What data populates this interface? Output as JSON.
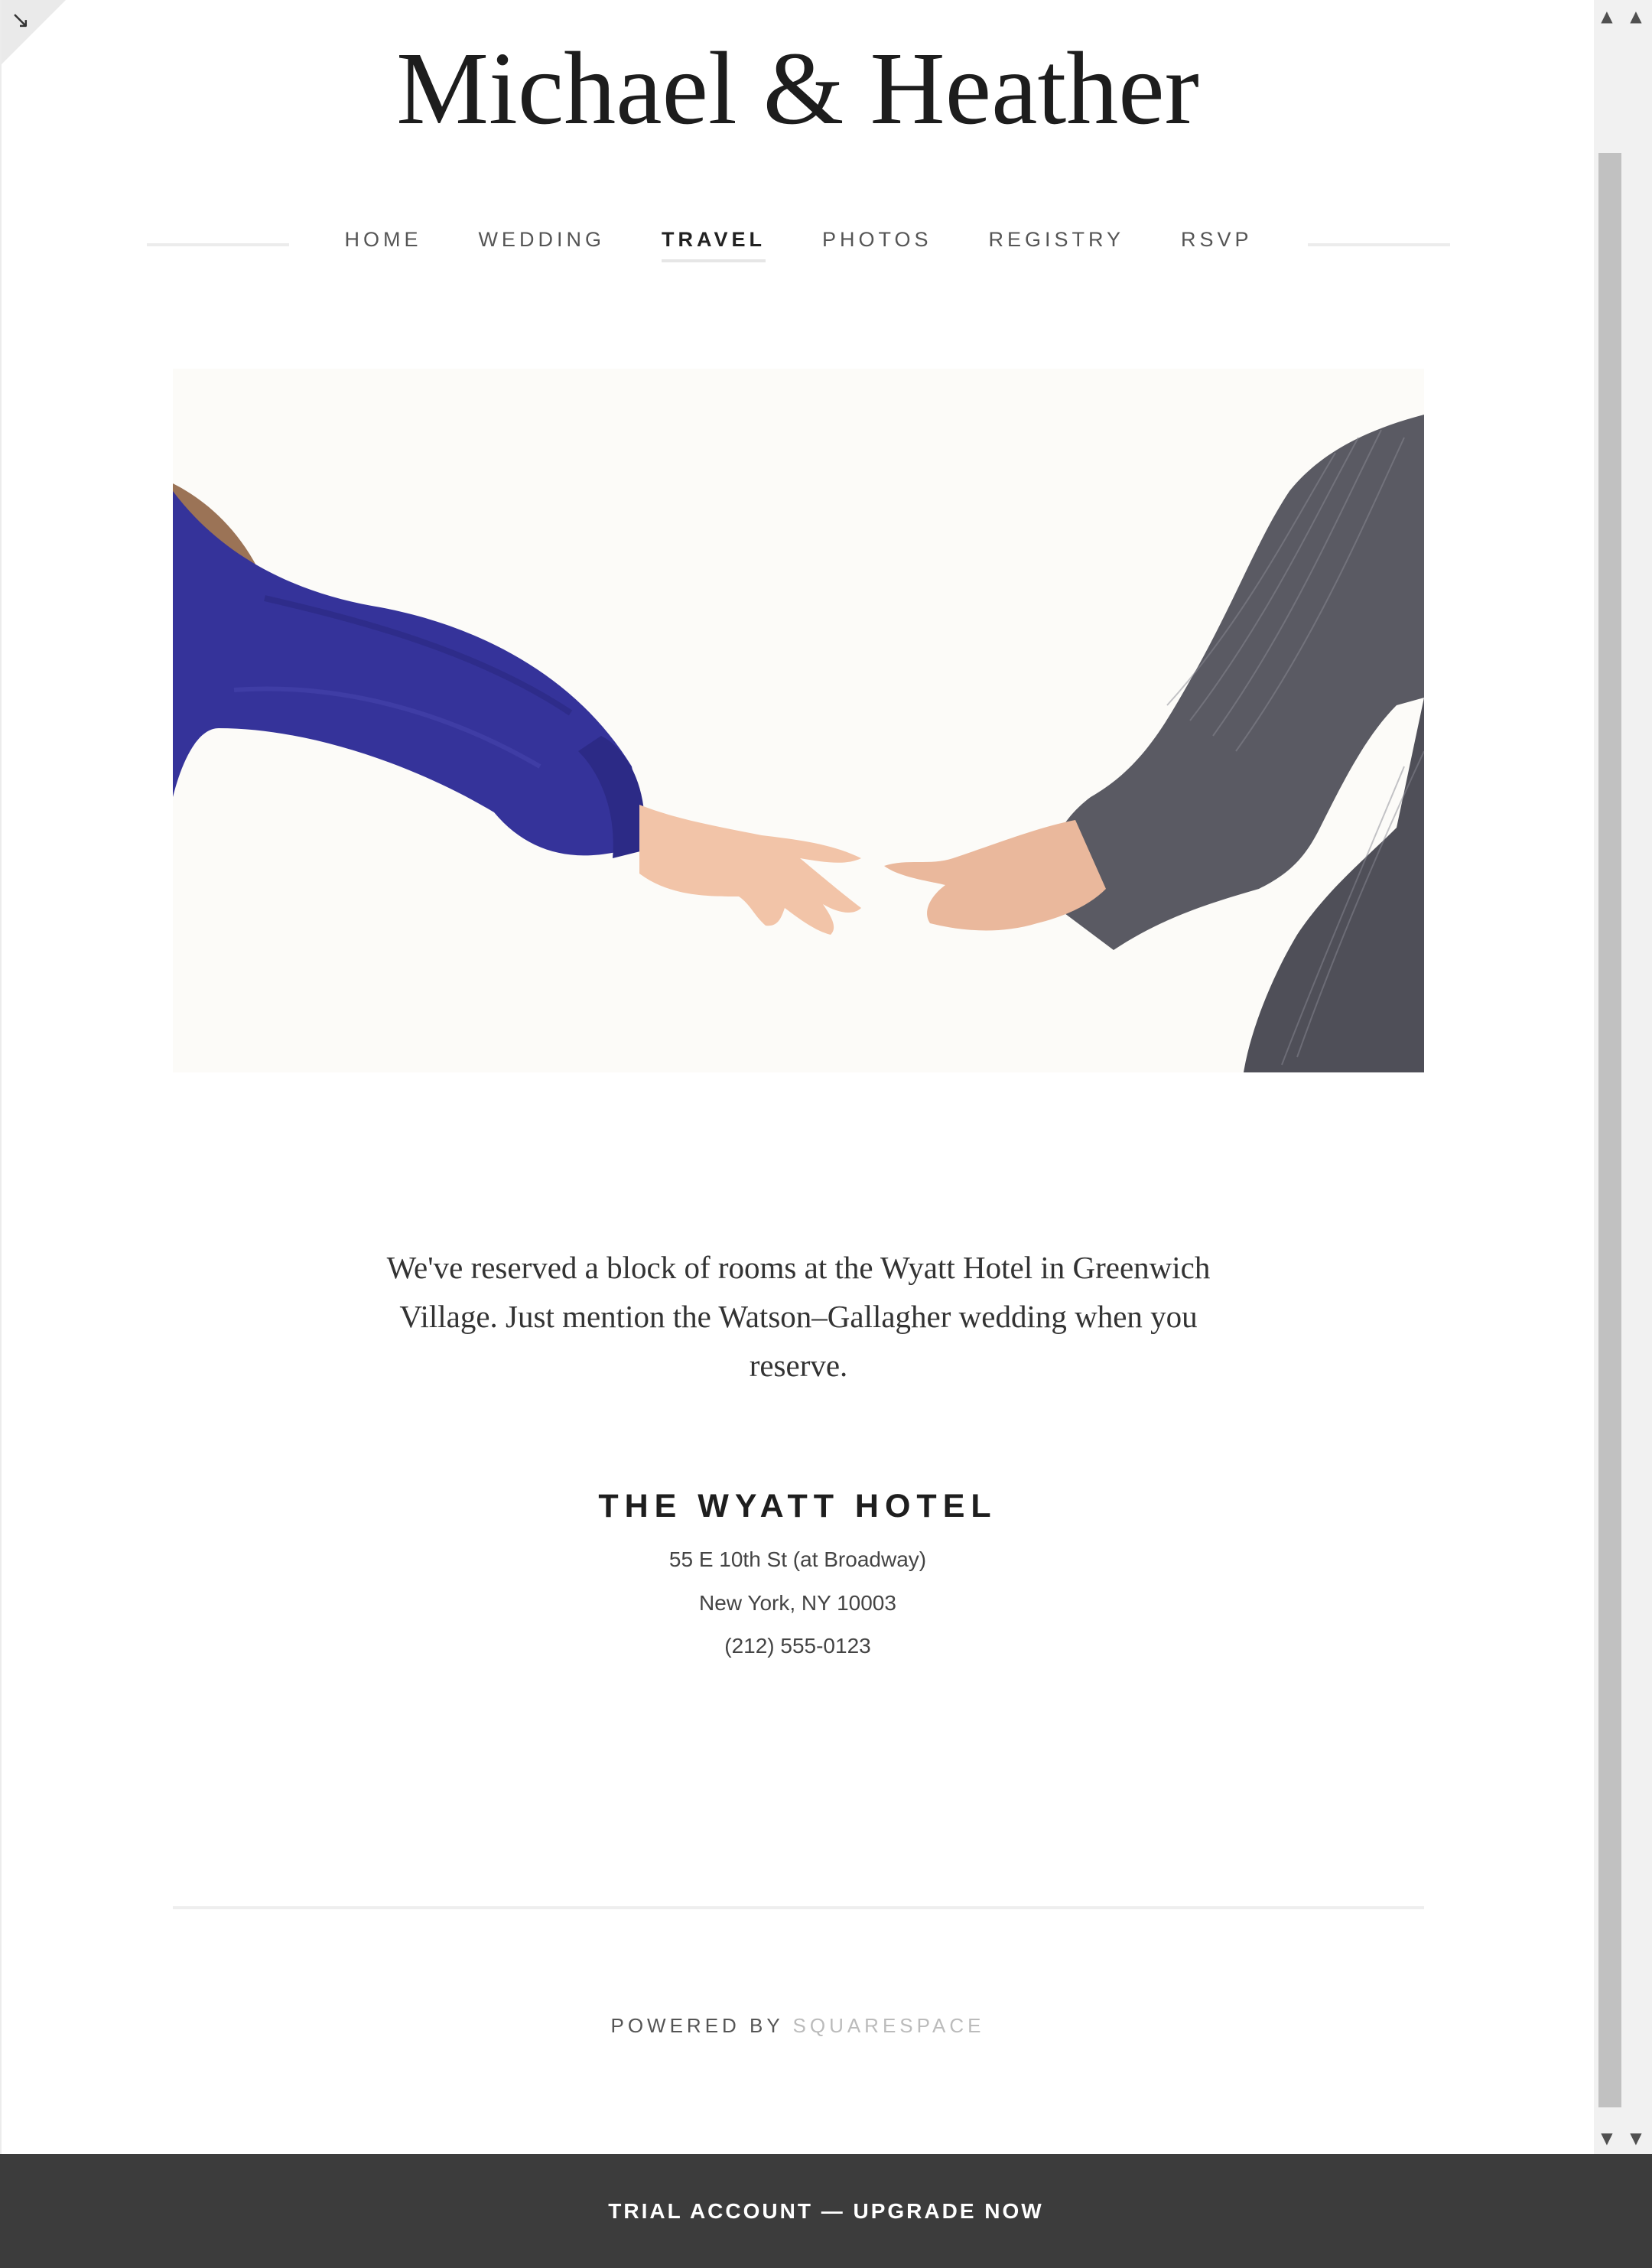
{
  "site": {
    "title": "Michael & Heather"
  },
  "nav": {
    "items": [
      {
        "label": "HOME"
      },
      {
        "label": "WEDDING"
      },
      {
        "label": "TRAVEL",
        "active": true
      },
      {
        "label": "PHOTOS"
      },
      {
        "label": "REGISTRY"
      },
      {
        "label": "RSVP"
      }
    ]
  },
  "main": {
    "intro": "We've reserved a block of rooms at the Wyatt Hotel in Greenwich Village. Just mention the Watson–Gallagher wedding when you reserve.",
    "hotel": {
      "name": "THE WYATT HOTEL",
      "address_line1": "55 E 10th St (at Broadway)",
      "address_line2": "New York, NY 10003",
      "phone": "(212) 555-0123"
    }
  },
  "footer": {
    "powered_prefix": "POWERED BY",
    "powered_brand": "SQUARESPACE"
  },
  "trial_bar": {
    "label": "TRIAL ACCOUNT — UPGRADE NOW"
  },
  "icons": {
    "corner": "expand-arrow-icon",
    "scroll_up": "scroll-up-arrow-icon",
    "scroll_down": "scroll-down-arrow-icon"
  },
  "colors": {
    "trial_bar_bg": "#3c3c3c",
    "sleeve_blue": "#35339a",
    "suit_gray": "#5a5a63",
    "hero_bg": "#fcfbf8"
  }
}
